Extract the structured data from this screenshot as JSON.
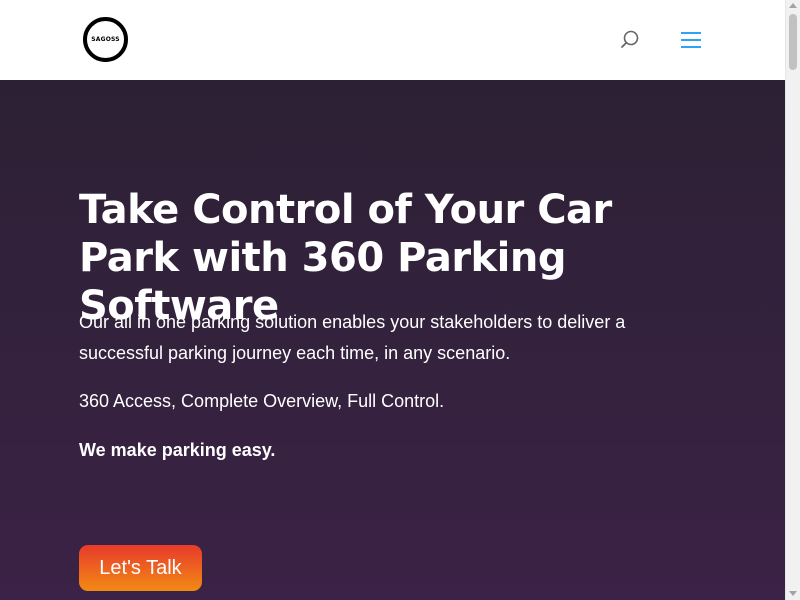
{
  "header": {
    "logo_text": "SAGOSS",
    "search_icon": "search-icon",
    "menu_icon": "hamburger-menu-icon",
    "accent_color": "#2ea3f2"
  },
  "hero": {
    "title": "Take Control of Your Car Park with 360 Parking Software",
    "description": "Our all in one parking solution enables your stakeholders to deliver a successful parking journey each time, in any scenario.",
    "tagline": "360 Access, Complete Overview, Full Control.",
    "strong_text": "We make parking easy.",
    "cta_label": "Let's Talk",
    "background_color": "#2c2134",
    "cta_gradient_top": "#e83a2c",
    "cta_gradient_bottom": "#f28a14"
  }
}
